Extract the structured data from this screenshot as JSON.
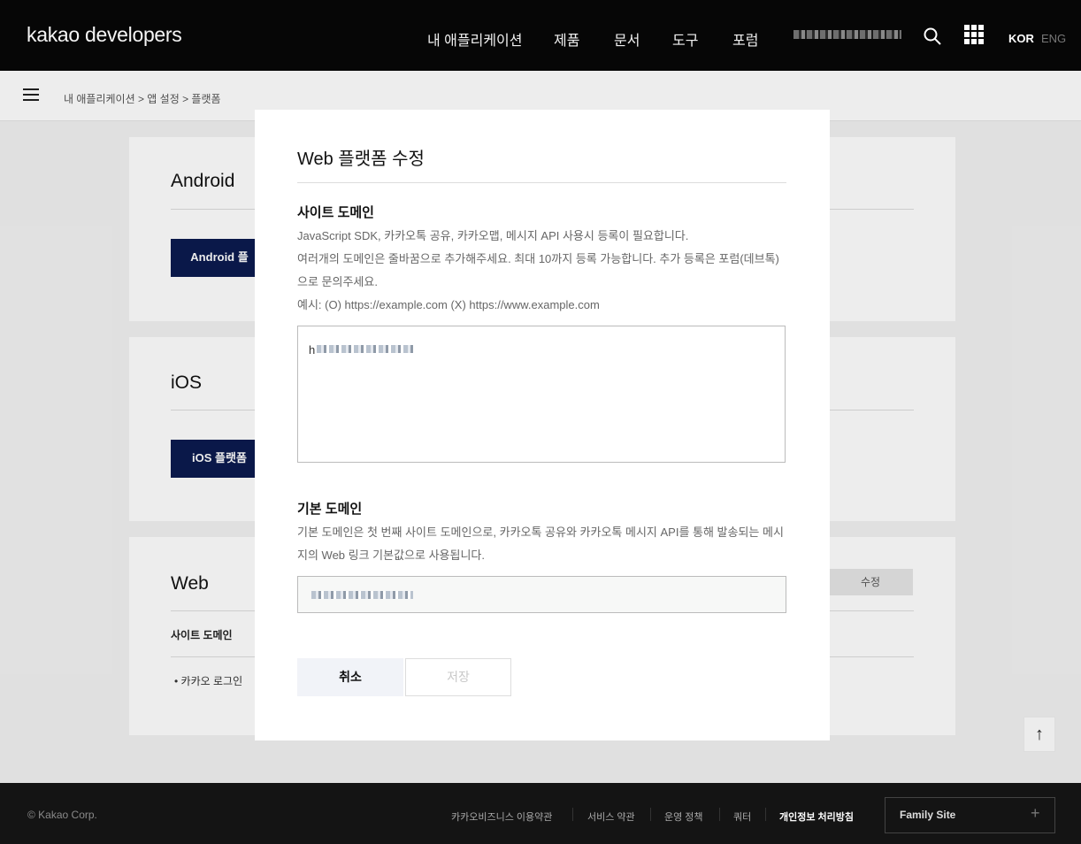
{
  "header": {
    "logo": "kakao developers",
    "nav": [
      "내 애플리케이션",
      "제품",
      "문서",
      "도구",
      "포럼"
    ],
    "lang_active": "KOR",
    "lang_other": "ENG"
  },
  "breadcrumb": "내 애플리케이션 > 앱 설정 > 플랫폼",
  "background": {
    "android": {
      "title": "Android",
      "button": "Android 플"
    },
    "ios": {
      "title": "iOS",
      "button": "iOS 플랫폼"
    },
    "web": {
      "title": "Web",
      "edit_button": "수정",
      "row_label": "사이트 도메인",
      "row_item": "• 카카오 로그인"
    }
  },
  "modal": {
    "title": "Web 플랫폼 수정",
    "site_domain": {
      "title": "사이트 도메인",
      "desc": [
        "JavaScript SDK, 카카오톡 공유, 카카오맵, 메시지 API 사용시 등록이 필요합니다.",
        "여러개의 도메인은 줄바꿈으로 추가해주세요. 최대 10까지 등록 가능합니다. 추가 등록은 포럼(데브톡)",
        "으로 문의주세요.",
        "예시: (O) https://example.com (X) https://www.example.com"
      ],
      "value_prefix": "h"
    },
    "base_domain": {
      "title": "기본 도메인",
      "desc": [
        "기본 도메인은 첫 번째 사이트 도메인으로, 카카오톡 공유와 카카오톡 메시지 API를 통해 발송되는 메시",
        "지의 Web 링크 기본값으로 사용됩니다."
      ]
    },
    "cancel": "취소",
    "save": "저장"
  },
  "footer": {
    "copyright": "© Kakao Corp.",
    "links": [
      "카카오비즈니스 이용약관",
      "서비스 약관",
      "운영 정책",
      "쿼터",
      "개인정보 처리방침"
    ],
    "family_site": "Family Site",
    "family_plus": "+"
  },
  "top_button": "↑"
}
